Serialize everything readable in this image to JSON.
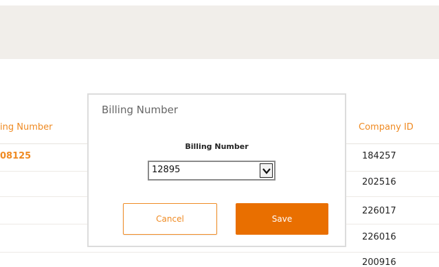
{
  "table": {
    "columns": {
      "billing_number": "ing Number",
      "company_id": "Company ID"
    },
    "rows": [
      {
        "billing_number": "08125",
        "company_id": "184257"
      },
      {
        "billing_number": "",
        "company_id": "202516"
      },
      {
        "billing_number": "",
        "company_id": "226017"
      },
      {
        "billing_number": "",
        "company_id": "226016"
      },
      {
        "billing_number": "",
        "company_id": "200916"
      }
    ]
  },
  "dialog": {
    "title": "Billing Number",
    "field_label": "Billing Number",
    "select_value": "12895",
    "cancel_label": "Cancel",
    "save_label": "Save"
  },
  "colors": {
    "accent": "#ef8a22",
    "save_button": "#e96f00",
    "top_band": "#f1eeea"
  },
  "icons": {
    "select_arrow": "chevron-down-icon"
  }
}
